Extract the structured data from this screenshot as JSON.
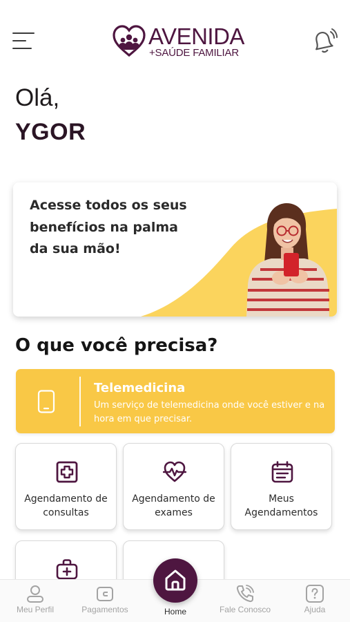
{
  "header": {
    "logo_name": "AVENIDA",
    "logo_sub": "+SAÚDE FAMILIAR",
    "menu_icon": "hamburger-menu-icon",
    "bell_icon": "notification-bell-icon"
  },
  "greeting": {
    "hello": "Olá,",
    "user": "YGOR"
  },
  "banner": {
    "text": "Acesse todos os seus benefícios na palma da sua mão!"
  },
  "section": {
    "title": "O que você precisa?"
  },
  "telemedicina": {
    "title": "Telemedicina",
    "description": "Um serviço de telemedicina onde você estiver e na hora em que precisar.",
    "icon": "smartphone-icon"
  },
  "services": [
    {
      "label": "Agendamento de consultas",
      "icon": "medical-cross-icon"
    },
    {
      "label": "Agendamento de exames",
      "icon": "heartbeat-icon"
    },
    {
      "label": "Meus Agendamentos",
      "icon": "calendar-icon"
    },
    {
      "label": "",
      "icon": "medical-bag-icon"
    },
    {
      "label": "",
      "icon": ""
    }
  ],
  "bottom_nav": [
    {
      "label": "Meu Perfil",
      "icon": "user-icon"
    },
    {
      "label": "Pagamentos",
      "icon": "wallet-icon"
    },
    {
      "label": "Home",
      "icon": "home-icon"
    },
    {
      "label": "Fale Conosco",
      "icon": "phone-icon"
    },
    {
      "label": "Ajuda",
      "icon": "help-icon"
    }
  ],
  "colors": {
    "brand": "#4e1640",
    "accent": "#f9c846",
    "nav_inactive": "#a3a3a3"
  }
}
